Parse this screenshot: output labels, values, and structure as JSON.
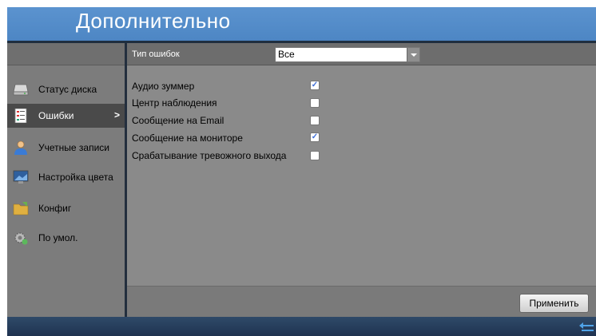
{
  "window": {
    "title": "Дополнительно"
  },
  "sidebar": {
    "items": [
      {
        "label": "Статус диска",
        "icon": "disk-icon",
        "selected": false
      },
      {
        "label": "Ошибки",
        "icon": "errors-icon",
        "selected": true,
        "arrow": ">"
      },
      {
        "label": "Учетные записи",
        "icon": "user-icon",
        "selected": false
      },
      {
        "label": "Настройка цвета",
        "icon": "monitor-icon",
        "selected": false
      },
      {
        "label": "Конфиг",
        "icon": "folder-icon",
        "selected": false
      },
      {
        "label": "По умол.",
        "icon": "gear-icon",
        "selected": false
      }
    ]
  },
  "main": {
    "error_type": {
      "label": "Тип ошибок",
      "value": "Все"
    },
    "options": [
      {
        "label": "Аудио зуммер",
        "checked": true
      },
      {
        "label": "Центр наблюдения",
        "checked": false
      },
      {
        "label": "Сообщение на Email",
        "checked": false
      },
      {
        "label": "Сообщение на мониторе",
        "checked": true
      },
      {
        "label": "Срабатывание тревожного выхода",
        "checked": false
      }
    ],
    "apply_label": "Применить"
  },
  "colors": {
    "title_bar": "#5b93cf",
    "selected_item": "#4a4a4a",
    "bottom_bar": "#1f3350"
  },
  "icons": {
    "back": "back-arrow-icon"
  }
}
